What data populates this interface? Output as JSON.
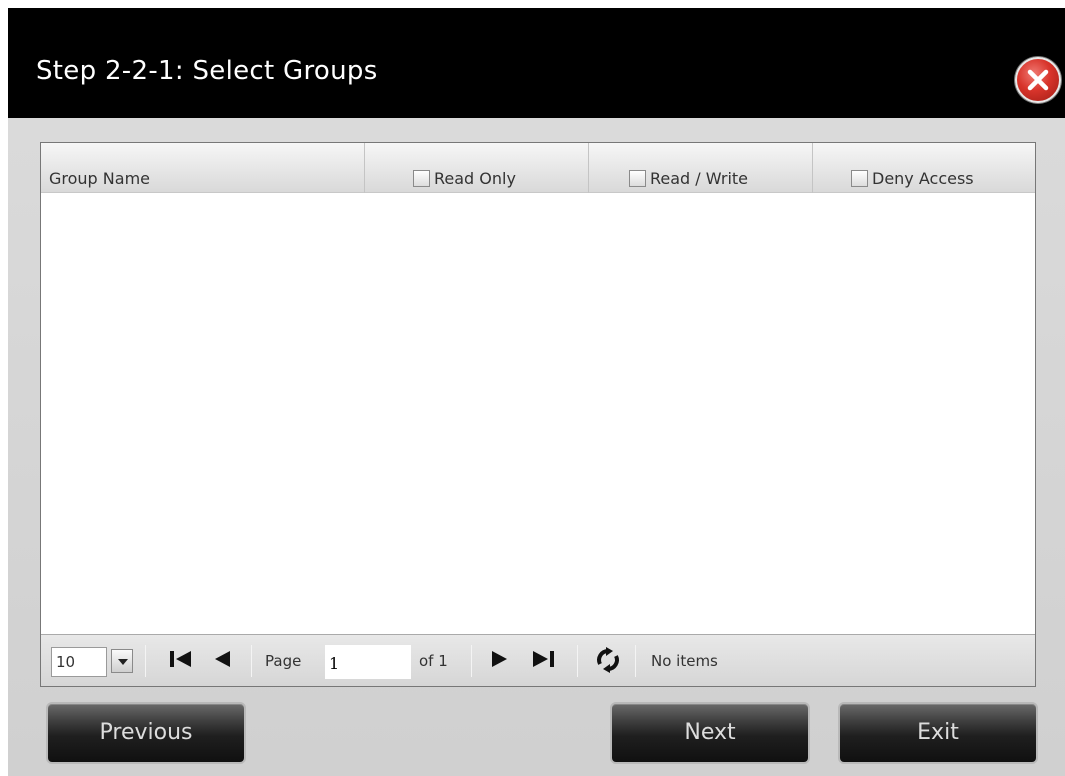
{
  "dialog": {
    "title": "Step 2-2-1: Select Groups"
  },
  "grid": {
    "columns": {
      "name": "Group Name",
      "read_only": "Read Only",
      "read_write": "Read / Write",
      "deny_access": "Deny Access"
    },
    "rows": []
  },
  "pager": {
    "page_size": "10",
    "page_label": "Page",
    "page_value": "1",
    "of_label": "of 1",
    "status": "No items"
  },
  "buttons": {
    "previous": "Previous",
    "next": "Next",
    "exit": "Exit"
  },
  "icons": {
    "close": "close-icon",
    "first": "first-page-icon",
    "prev": "prev-page-icon",
    "next": "next-page-icon",
    "last": "last-page-icon",
    "refresh": "refresh-icon"
  }
}
